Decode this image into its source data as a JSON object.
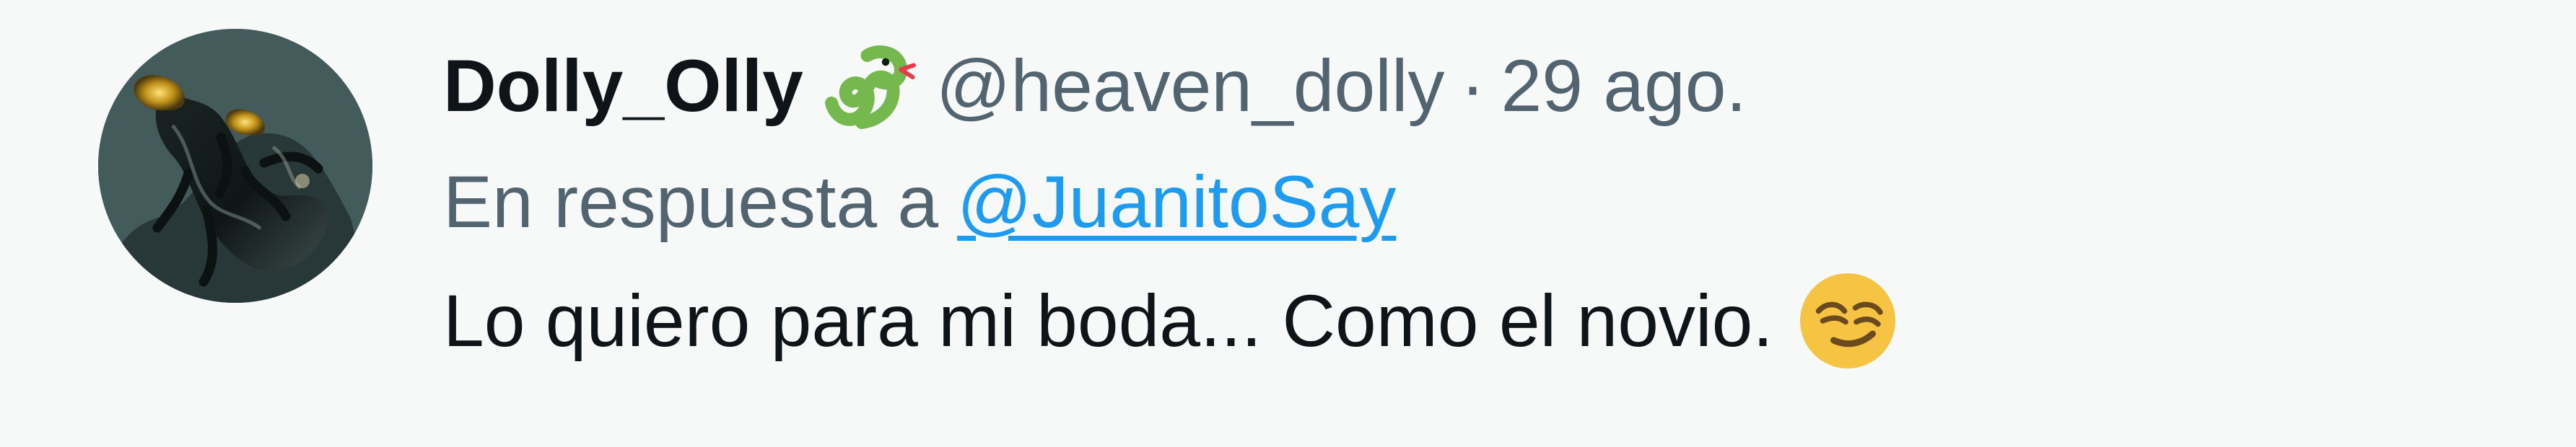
{
  "tweet": {
    "display_name": "Dolly_Olly",
    "handle": "@heaven_dolly",
    "separator": "·",
    "date": "29 ago.",
    "reply_prefix": "En respuesta a",
    "reply_to": "@JuanitoSay",
    "text": "Lo quiero para mi boda... Como el novio."
  },
  "icons": {
    "name_badge": "snake-icon",
    "text_emoji": "smirk-icon",
    "avatar": "dark-creature-avatar"
  },
  "colors": {
    "background": "#f7f9f9",
    "primary_text": "#0f1419",
    "secondary_text": "#536471",
    "link": "#1d9bf0",
    "snake_green": "#75b84d",
    "emoji_yellow": "#f6c342"
  }
}
